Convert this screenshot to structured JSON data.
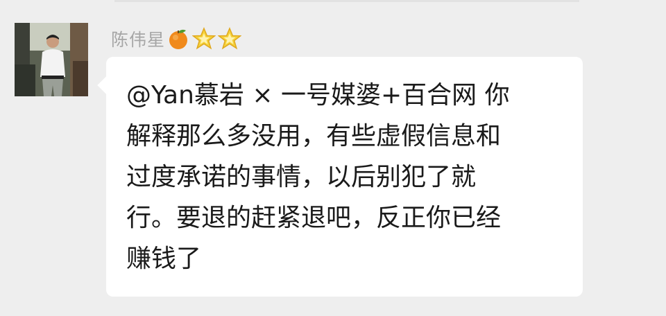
{
  "sender": {
    "name": "陈伟星",
    "badges": [
      {
        "icon": "orange-fruit-icon",
        "color": "#f08a1c"
      },
      {
        "icon": "gold-star-icon",
        "color": "#f5d23a"
      },
      {
        "icon": "gold-star-icon",
        "color": "#f5d23a"
      }
    ]
  },
  "message": {
    "lines": [
      "@Yan慕岩 × 一号媒婆+百合网 你",
      "解释那么多没用，有些虚假信息和",
      "过度承诺的事情，以后别犯了就",
      "行。要退的赶紧退吧，反正你已经",
      "赚钱了"
    ]
  },
  "colors": {
    "page_background": "#eeeeee",
    "bubble_background": "#ffffff",
    "sender_name": "#a6a6a6",
    "message_text": "#1a1a1a"
  }
}
